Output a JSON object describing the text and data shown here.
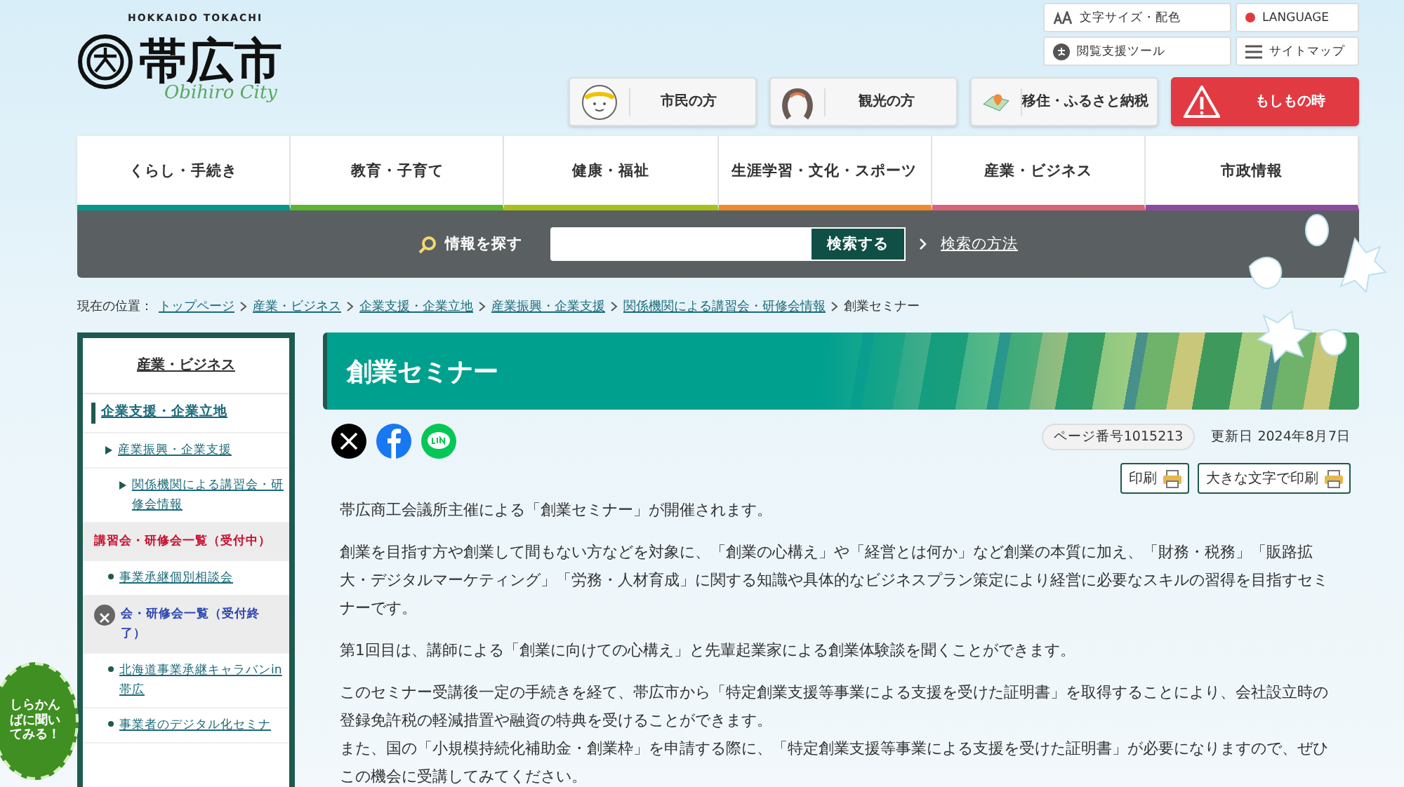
{
  "logo": {
    "tagline": "HOKKAIDO TOKACHI",
    "name": "帯広市",
    "script": "Obihiro City"
  },
  "utility_links": [
    {
      "label": "文字サイズ・配色",
      "kind": "text-size"
    },
    {
      "label": "LANGUAGE",
      "kind": "language"
    },
    {
      "label": "閲覧支援ツール",
      "kind": "assist"
    },
    {
      "label": "サイトマップ",
      "kind": "sitemap"
    }
  ],
  "audience_buttons": [
    {
      "label": "市民の方",
      "kind": "citizen"
    },
    {
      "label": "観光の方",
      "kind": "tourist"
    },
    {
      "label": "移住・ふるさと納税",
      "kind": "migration"
    },
    {
      "label": "もしもの時",
      "kind": "emergency"
    }
  ],
  "nav": [
    {
      "label": "くらし・手続き",
      "color": "#00998a"
    },
    {
      "label": "教育・子育て",
      "color": "#5cb531"
    },
    {
      "label": "健康・福祉",
      "color": "#a8c11a"
    },
    {
      "label": "生涯学習・文化・スポーツ",
      "color": "#ee8a2a"
    },
    {
      "label": "産業・ビジネス",
      "color": "#d9647a"
    },
    {
      "label": "市政情報",
      "color": "#8e4a9e"
    }
  ],
  "search": {
    "label": "情報を探す",
    "button": "検索する",
    "help_link": "検索の方法"
  },
  "breadcrumb": {
    "prefix": "現在の位置：",
    "links": [
      "トップページ",
      "産業・ビジネス",
      "企業支援・企業立地",
      "産業振興・企業支援",
      "関係機関による講習会・研修会情報"
    ],
    "current": "創業セミナー"
  },
  "sidebar": {
    "heading": "産業・ビジネス",
    "items": [
      {
        "label": "企業支援・企業立地",
        "kind": "section",
        "children": [
          {
            "label": "産業振興・企業支援",
            "kind": "parent",
            "children": [
              {
                "label": "関係機関による講習会・研修会情報",
                "kind": "parent",
                "children": [
                  {
                    "label": "講習会・研修会一覧（受付中）",
                    "kind": "group",
                    "selected": true
                  },
                  {
                    "label": "事業承継個別相談会",
                    "kind": "link"
                  },
                  {
                    "label": "会・研修会一覧（受付終了）",
                    "kind": "group",
                    "selected": false
                  },
                  {
                    "label": "北海道事業承継キャラバンin帯広",
                    "kind": "link"
                  },
                  {
                    "label": "事業者のデジタル化セミナ",
                    "kind": "link"
                  }
                ]
              }
            ]
          }
        ]
      }
    ]
  },
  "chat_badge": {
    "label": "しらかんばに聞いてみる！"
  },
  "page": {
    "title": "創業セミナー",
    "page_number": "ページ番号1015213",
    "updated": "更新日 2024年8月7日",
    "print_buttons": [
      "印刷",
      "大きな文字で印刷"
    ],
    "paragraphs": [
      [
        "帯広商工会議所主催による「創業セミナー」が開催されます。"
      ],
      [
        "創業を目指す方や創業して間もない方などを対象に、「創業の心構え」や「経営とは何か」など創業の本質に加え、「財務・税務」「販路拡大・デジタルマーケティング」「労務・人材育成」に関する知識や具体的なビジネスプラン策定により経営に必要なスキルの習得を目指すセミナーです。"
      ],
      [
        "第1回目は、講師による「創業に向けての心構え」と先輩起業家による創業体験談を聞くことができます。"
      ],
      [
        "このセミナー受講後一定の手続きを経て、帯広市から「特定創業支援等事業による支援を受けた証明書」を取得することにより、会社設立時の登録免許税の軽減措置や融資の特典を受けることができます。",
        "また、国の「小規模持続化補助金・創業枠」を申請する際に、「特定創業支援等事業による支援を受けた証明書」が必要になりますので、ぜひこの機会に受講してみてください。"
      ]
    ]
  }
}
